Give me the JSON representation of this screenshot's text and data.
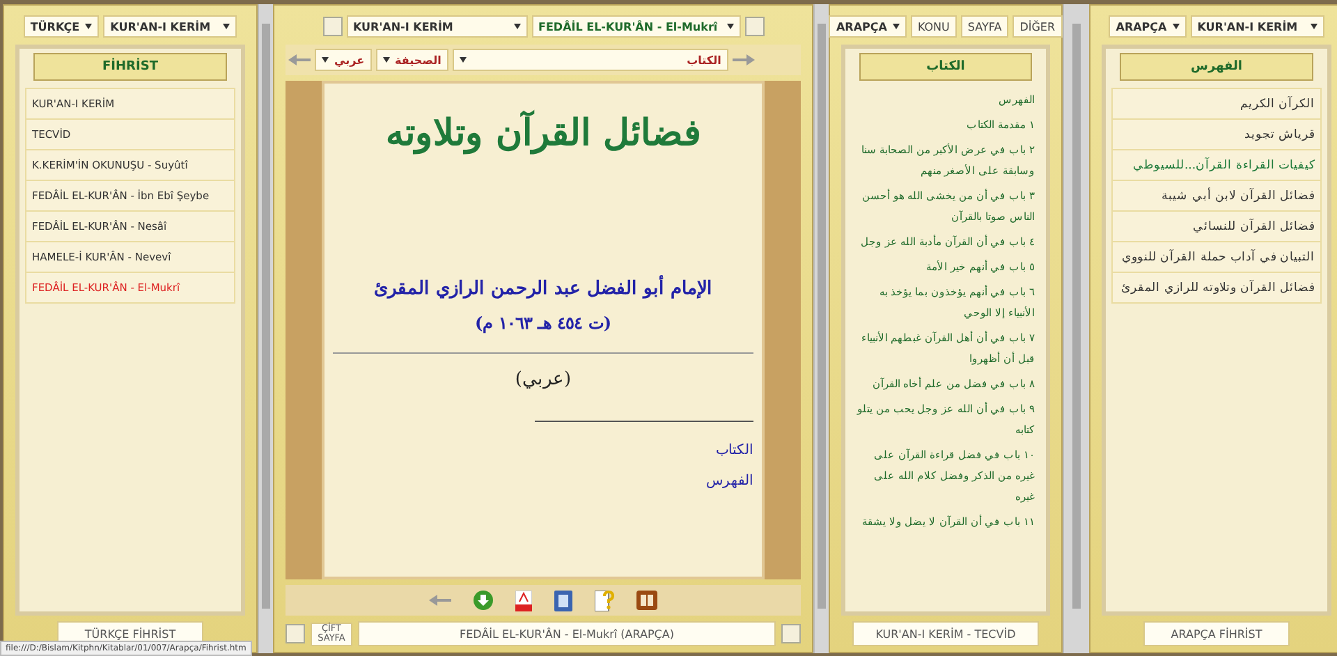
{
  "left_panel": {
    "language_select": "TÜRKÇE",
    "book_select": "KUR'AN-I KERİM",
    "header": "FİHRİST",
    "items": [
      {
        "label": "KUR'AN-I KERİM",
        "selected": false
      },
      {
        "label": "TECVİD",
        "selected": false
      },
      {
        "label": "K.KERİM'İN OKUNUŞU - Suyûtî",
        "selected": false
      },
      {
        "label": "FEDÂİL EL-KUR'ÂN - İbn Ebî Şeybe",
        "selected": false
      },
      {
        "label": "FEDÂİL EL-KUR'ÂN - Nesâî",
        "selected": false
      },
      {
        "label": "HAMELE-İ KUR'ÂN - Nevevî",
        "selected": false
      },
      {
        "label": "FEDÂİL EL-KUR'ÂN - El-Mukrî",
        "selected": true
      }
    ],
    "footer": "TÜRKÇE FİHRİST"
  },
  "reader": {
    "book_select": "KUR'AN-I KERİM",
    "work_select": "FEDÂİL EL-KUR'ÂN - El-Mukrî",
    "nav_selects": [
      "الكتاب",
      "الصحيفة",
      "عربي"
    ],
    "page": {
      "title": "فضائل القرآن وتلاوته",
      "author": "الإمام أبو الفضل عبد الرحمن الرازي المقرئ",
      "dates": "(ت ٤٥٤ هـ ١٠٦٣ م)",
      "language": "(عربي)",
      "links": [
        "الكتاب",
        "الفهرس"
      ]
    },
    "double_page": "ÇİFT SAYFA",
    "footer": "FEDÂİL EL-KUR'ÂN - El-Mukrî (ARAPÇA)"
  },
  "contents_panel": {
    "language_select": "ARAPÇA",
    "topic_tab": {
      "label": "KONU",
      "selected": false
    },
    "page_tab": {
      "label": "SAYFA",
      "selected": false
    },
    "other_tab": {
      "label": "DİĞER",
      "selected": false
    },
    "header": "الكتاب",
    "entries": [
      "الفهرس",
      "١ مقدمة الكتاب",
      "٢ باب في عرض الأكبر من الصحابة سنا وسابقة على الأصغر منهم",
      "٣ باب في أن من يخشى الله هو أحسن الناس صوتا بالقرآن",
      "٤ باب في أن القرآن مأدبة الله عز وجل",
      "٥ باب في أنهم خير الأمة",
      "٦ باب في أنهم يؤخذون بما يؤخذ به الأنبياء إلا الوحي",
      "٧ باب في أن أهل القرآن غبطهم الأنبياء قبل أن أظهروا",
      "٨ باب في فضل من علم أخاه القرآن",
      "٩ باب في أن الله عز وجل يحب من يتلو كتابه",
      "١٠ باب في فضل قراءة القرآن على غيره من الذكر وفضل كلام الله على غيره",
      "١١ باب في أن القرآن لا يضل ولا يشقة"
    ],
    "footer": "KUR'AN-I KERİM - TECVİD"
  },
  "right_panel": {
    "language_select": "ARAPÇA",
    "book_select": "KUR'AN-I KERİM",
    "header": "الفهرس",
    "items": [
      {
        "label": "الكرآن الكريم",
        "selected": false
      },
      {
        "label": "قرياش تجويد",
        "selected": false
      },
      {
        "label": "كيفيات القراءة القرآن...للسيوطي",
        "selected": true
      },
      {
        "label": "فضائل القرآن لابن أبي شيبة",
        "selected": false
      },
      {
        "label": "فضائل القرآن للنسائي",
        "selected": false
      },
      {
        "label": "التبيان في آداب حملة القرآن للنووي",
        "selected": false
      },
      {
        "label": "فضائل القرآن وتلاوته للرازي المقرئ",
        "selected": false
      }
    ],
    "footer": "ARAPÇA FİHRİST"
  },
  "status_bar": "file:///D:/Bislam/Kitphn/Kitablar/01/007/Arapça/Fihrist.htm"
}
